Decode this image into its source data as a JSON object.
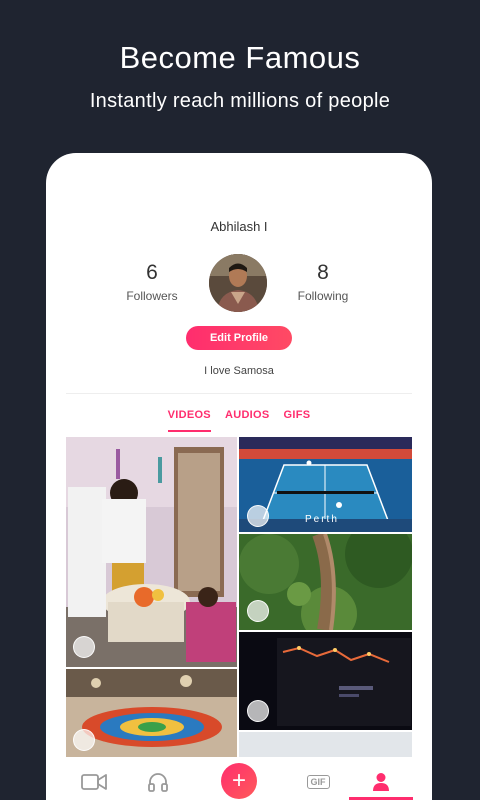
{
  "promo": {
    "title": "Become Famous",
    "subtitle": "Instantly reach millions of people"
  },
  "profile": {
    "name": "Abhilash I",
    "followers": {
      "count": "6",
      "label": "Followers"
    },
    "following": {
      "count": "8",
      "label": "Following"
    },
    "edit_label": "Edit Profile",
    "bio": "I love Samosa"
  },
  "tabs": [
    {
      "label": "VIDEOS",
      "active": true
    },
    {
      "label": "AUDIOS",
      "active": false
    },
    {
      "label": "GIFS",
      "active": false
    }
  ],
  "media": {
    "tennis_overlay": "Perth"
  },
  "bottom_nav": {
    "add_glyph": "+",
    "gif_label": "GIF",
    "active_item": "profile"
  },
  "colors": {
    "accent": "#ff2d6e",
    "background": "#1f2430"
  }
}
